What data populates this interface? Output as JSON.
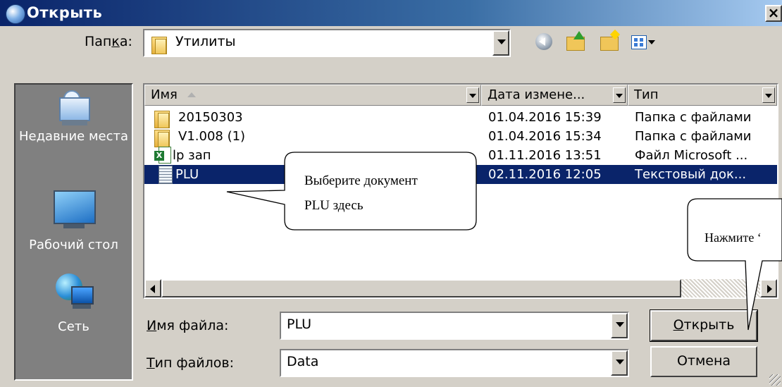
{
  "window": {
    "title": "Открыть",
    "close_glyph": "×"
  },
  "folder_bar": {
    "label_pre": "Пап",
    "label_mnemonic": "к",
    "label_post": "а:",
    "current_folder": "Утилиты",
    "toolbar_icons": [
      "back-icon",
      "up-folder-icon",
      "new-folder-icon",
      "view-menu-icon"
    ]
  },
  "places": [
    {
      "label": "Недавние места",
      "icon": "recent-places-icon"
    },
    {
      "label": "Рабочий стол",
      "icon": "desktop-icon"
    },
    {
      "label": "Сеть",
      "icon": "network-icon"
    }
  ],
  "file_list": {
    "columns": [
      "Имя",
      "Дата измене...",
      "Тип"
    ],
    "rows": [
      {
        "name": "20150303",
        "date": "01.04.2016 15:39",
        "type": "Папка с файлами",
        "icon": "folder-icon",
        "selected": false
      },
      {
        "name": "V1.008 (1)",
        "date": "01.04.2016 15:34",
        "type": "Папка с файлами",
        "icon": "folder-icon",
        "selected": false
      },
      {
        "name": "lp зап",
        "date": "01.11.2016 13:51",
        "type": "Файл Microsoft ...",
        "icon": "excel-file-icon",
        "selected": false
      },
      {
        "name": "PLU",
        "date": "02.11.2016 12:05",
        "type": "Текстовый док...",
        "icon": "text-file-icon",
        "selected": true
      }
    ]
  },
  "filename": {
    "label_mnemonic": "И",
    "label_rest": "мя файла:",
    "value": "PLU"
  },
  "filetype": {
    "label_mnemonic": "Т",
    "label_rest": "ип файлов:",
    "value": "Data"
  },
  "buttons": {
    "open_mnemonic": "О",
    "open_rest": "ткрыть",
    "cancel": "Отмена"
  },
  "callouts": {
    "select_doc_line1": "Выберите   документ",
    "select_doc_line2": "PLU здесь",
    "press_open": "Нажмите ‘"
  },
  "colors": {
    "selection": "#0a246a",
    "window_bg": "#d4d0c8",
    "places_bg": "#808080"
  }
}
